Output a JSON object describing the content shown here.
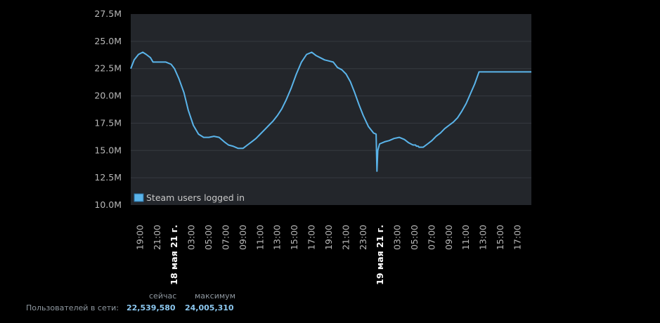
{
  "chart_data": {
    "type": "line",
    "title": "",
    "xlabel": "",
    "ylabel": "",
    "ylim": [
      10.0,
      27.5
    ],
    "y_ticks": [
      "10.0M",
      "12.5M",
      "15.0M",
      "17.5M",
      "20.0M",
      "22.5M",
      "25.0M",
      "27.5M"
    ],
    "x_ticks": [
      "19:00",
      "21:00",
      "18 мая 21 г.",
      "03:00",
      "05:00",
      "07:00",
      "09:00",
      "11:00",
      "13:00",
      "15:00",
      "17:00",
      "19:00",
      "21:00",
      "23:00",
      "19 мая 21 г.",
      "03:00",
      "05:00",
      "07:00",
      "09:00",
      "11:00",
      "13:00",
      "15:00",
      "17:00"
    ],
    "x_tick_bold": [
      2,
      14
    ],
    "x_range_hours": [
      17.9,
      64.6
    ],
    "grid": true,
    "legend_position": "bottom-left",
    "series": [
      {
        "name": "Steam users logged in",
        "color": "#5ab4ea",
        "x_hours": [
          17.9,
          18.3,
          18.8,
          19.3,
          19.7,
          20.2,
          20.5,
          20.9,
          21.4,
          22.0,
          22.6,
          23.0,
          23.5,
          24.1,
          24.6,
          25.2,
          25.8,
          26.4,
          27.0,
          27.6,
          28.2,
          28.8,
          29.3,
          29.8,
          30.4,
          31.0,
          31.5,
          32.0,
          32.5,
          33.0,
          33.5,
          34.0,
          34.5,
          35.0,
          35.5,
          36.0,
          36.6,
          37.2,
          37.8,
          38.4,
          39.0,
          39.5,
          40.0,
          40.5,
          41.0,
          41.5,
          42.0,
          42.5,
          43.0,
          43.5,
          44.0,
          44.5,
          45.0,
          45.6,
          46.2,
          46.5,
          46.6,
          46.7,
          46.9,
          47.5,
          48.0,
          48.6,
          49.2,
          49.8,
          50.3,
          50.8,
          51.1,
          51.2,
          51.3,
          51.4,
          51.5,
          52.0,
          52.5,
          53.0,
          53.5,
          54.0,
          54.5,
          55.0,
          55.5,
          56.0,
          56.5,
          57.0,
          57.5,
          58.0,
          58.5,
          59.0,
          59.5,
          60.0,
          60.5,
          61.0,
          61.5,
          62.0,
          62.5,
          63.0,
          63.5,
          64.0,
          64.6
        ],
        "values": [
          22.5,
          23.3,
          23.8,
          24.0,
          23.8,
          23.5,
          23.1,
          23.1,
          23.1,
          23.1,
          22.9,
          22.5,
          21.6,
          20.3,
          18.7,
          17.3,
          16.5,
          16.2,
          16.2,
          16.3,
          16.2,
          15.8,
          15.5,
          15.4,
          15.2,
          15.2,
          15.5,
          15.8,
          16.1,
          16.5,
          16.9,
          17.3,
          17.7,
          18.2,
          18.8,
          19.6,
          20.7,
          22.0,
          23.1,
          23.8,
          24.0,
          23.7,
          23.5,
          23.3,
          23.2,
          23.1,
          22.6,
          22.4,
          22.0,
          21.3,
          20.3,
          19.2,
          18.2,
          17.2,
          16.6,
          16.5,
          13.1,
          15.0,
          15.6,
          15.8,
          15.9,
          16.1,
          16.2,
          16.0,
          15.7,
          15.5,
          15.5,
          15.4,
          15.4,
          15.4,
          15.3,
          15.3,
          15.6,
          15.9,
          16.3,
          16.6,
          17.0,
          17.3,
          17.6,
          18.0,
          18.6,
          19.3,
          20.2,
          21.1,
          22.2,
          22.2,
          22.2,
          22.2,
          22.2,
          22.2,
          22.2,
          22.2,
          22.2,
          22.2,
          22.2,
          22.2,
          22.2
        ]
      }
    ]
  },
  "stats": {
    "header_now": "сейчас",
    "header_max": "максимум",
    "label_online": "Пользователей в сети:",
    "value_now": "22,539,580",
    "value_max": "24,005,310"
  }
}
